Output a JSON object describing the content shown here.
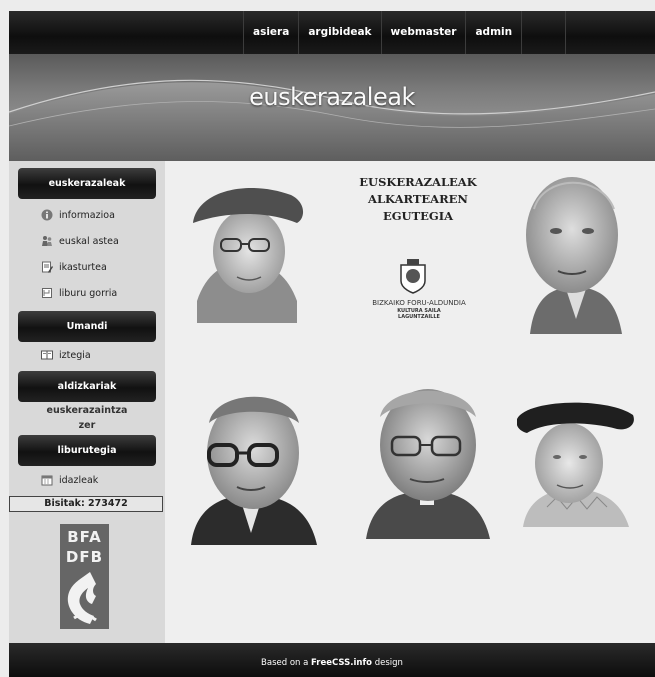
{
  "nav": {
    "items": [
      "asiera",
      "argibideak",
      "webmaster",
      "admin"
    ]
  },
  "banner": {
    "title": "euskerazaleak"
  },
  "sidebar": {
    "section1": {
      "title": "euskerazaleak",
      "items": [
        {
          "label": "informazioa",
          "icon": "info-icon"
        },
        {
          "label": "euskal astea",
          "icon": "people-icon"
        },
        {
          "label": "ikasturtea",
          "icon": "document-icon"
        },
        {
          "label": "liburu gorria",
          "icon": "book-icon"
        }
      ]
    },
    "section2": {
      "title": "Umandi",
      "items": [
        {
          "label": "iztegia",
          "icon": "dictionary-icon"
        }
      ]
    },
    "section3": {
      "title": "aldizkariak",
      "links": [
        "euskerazaintza",
        "zer"
      ]
    },
    "section4": {
      "title": "liburutegia",
      "items": [
        {
          "label": "idazleak",
          "icon": "calendar-icon"
        }
      ]
    },
    "visits": "Bisitak: 273472",
    "logo": [
      "BFA",
      "DFB"
    ]
  },
  "content": {
    "calendar_title": [
      "EUSKERAZALEAK",
      "ALKARTEAREN",
      "EGUTEGIA"
    ],
    "institution": "BIZKAIKO FORU-ALDUNDIA",
    "department": [
      "KULTURA SAILA",
      "LAGUNTZAILLE"
    ]
  },
  "footer": {
    "prefix": "Based on a ",
    "brand": "FreeCSS.info",
    "suffix": " design"
  }
}
